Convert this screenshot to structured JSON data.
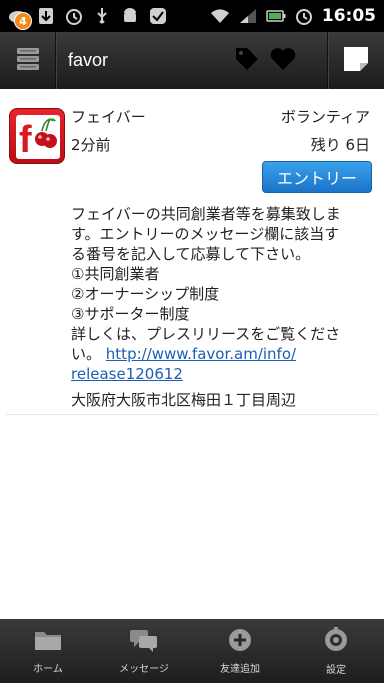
{
  "status_bar": {
    "notification_count": "4",
    "time": "16:05",
    "icons_left": [
      "cloud-icon",
      "download-icon",
      "alarm-icon",
      "usb-icon",
      "android-icon",
      "check-icon"
    ],
    "icons_right": [
      "wifi-icon",
      "signal-icon",
      "battery-icon",
      "alarm-icon"
    ]
  },
  "action_bar": {
    "title": "favor",
    "actions": [
      "tag-icon",
      "heart-icon",
      "note-icon"
    ]
  },
  "item": {
    "app_name": "フェイバー",
    "category": "ボランティア",
    "posted": "2分前",
    "remaining": "残り 6日",
    "entry_label": "エントリー",
    "description_lines": [
      "フェイバーの共同創業者等を募集致しま",
      "す。エントリーのメッセージ欄に該当す",
      "る番号を記入して応募して下さい。",
      "①共同創業者",
      "②オーナーシップ制度",
      "③サポーター制度",
      "詳しくは、プレスリリースをご覧くださ"
    ],
    "desc_tail": "い。",
    "link_line1": "http://www.favor.am/info/",
    "link_line2": "release120612",
    "location": "大阪府大阪市北区梅田１丁目周辺"
  },
  "bottom_nav": [
    {
      "label": "ホーム",
      "icon": "folder-icon"
    },
    {
      "label": "メッセージ",
      "icon": "chat-icon"
    },
    {
      "label": "友達追加",
      "icon": "add-friend-icon"
    },
    {
      "label": "設定",
      "icon": "settings-icon"
    }
  ],
  "colors": {
    "accent": "#1a73c8",
    "link": "#1a5fb4",
    "logo_red": "#d81a24"
  }
}
